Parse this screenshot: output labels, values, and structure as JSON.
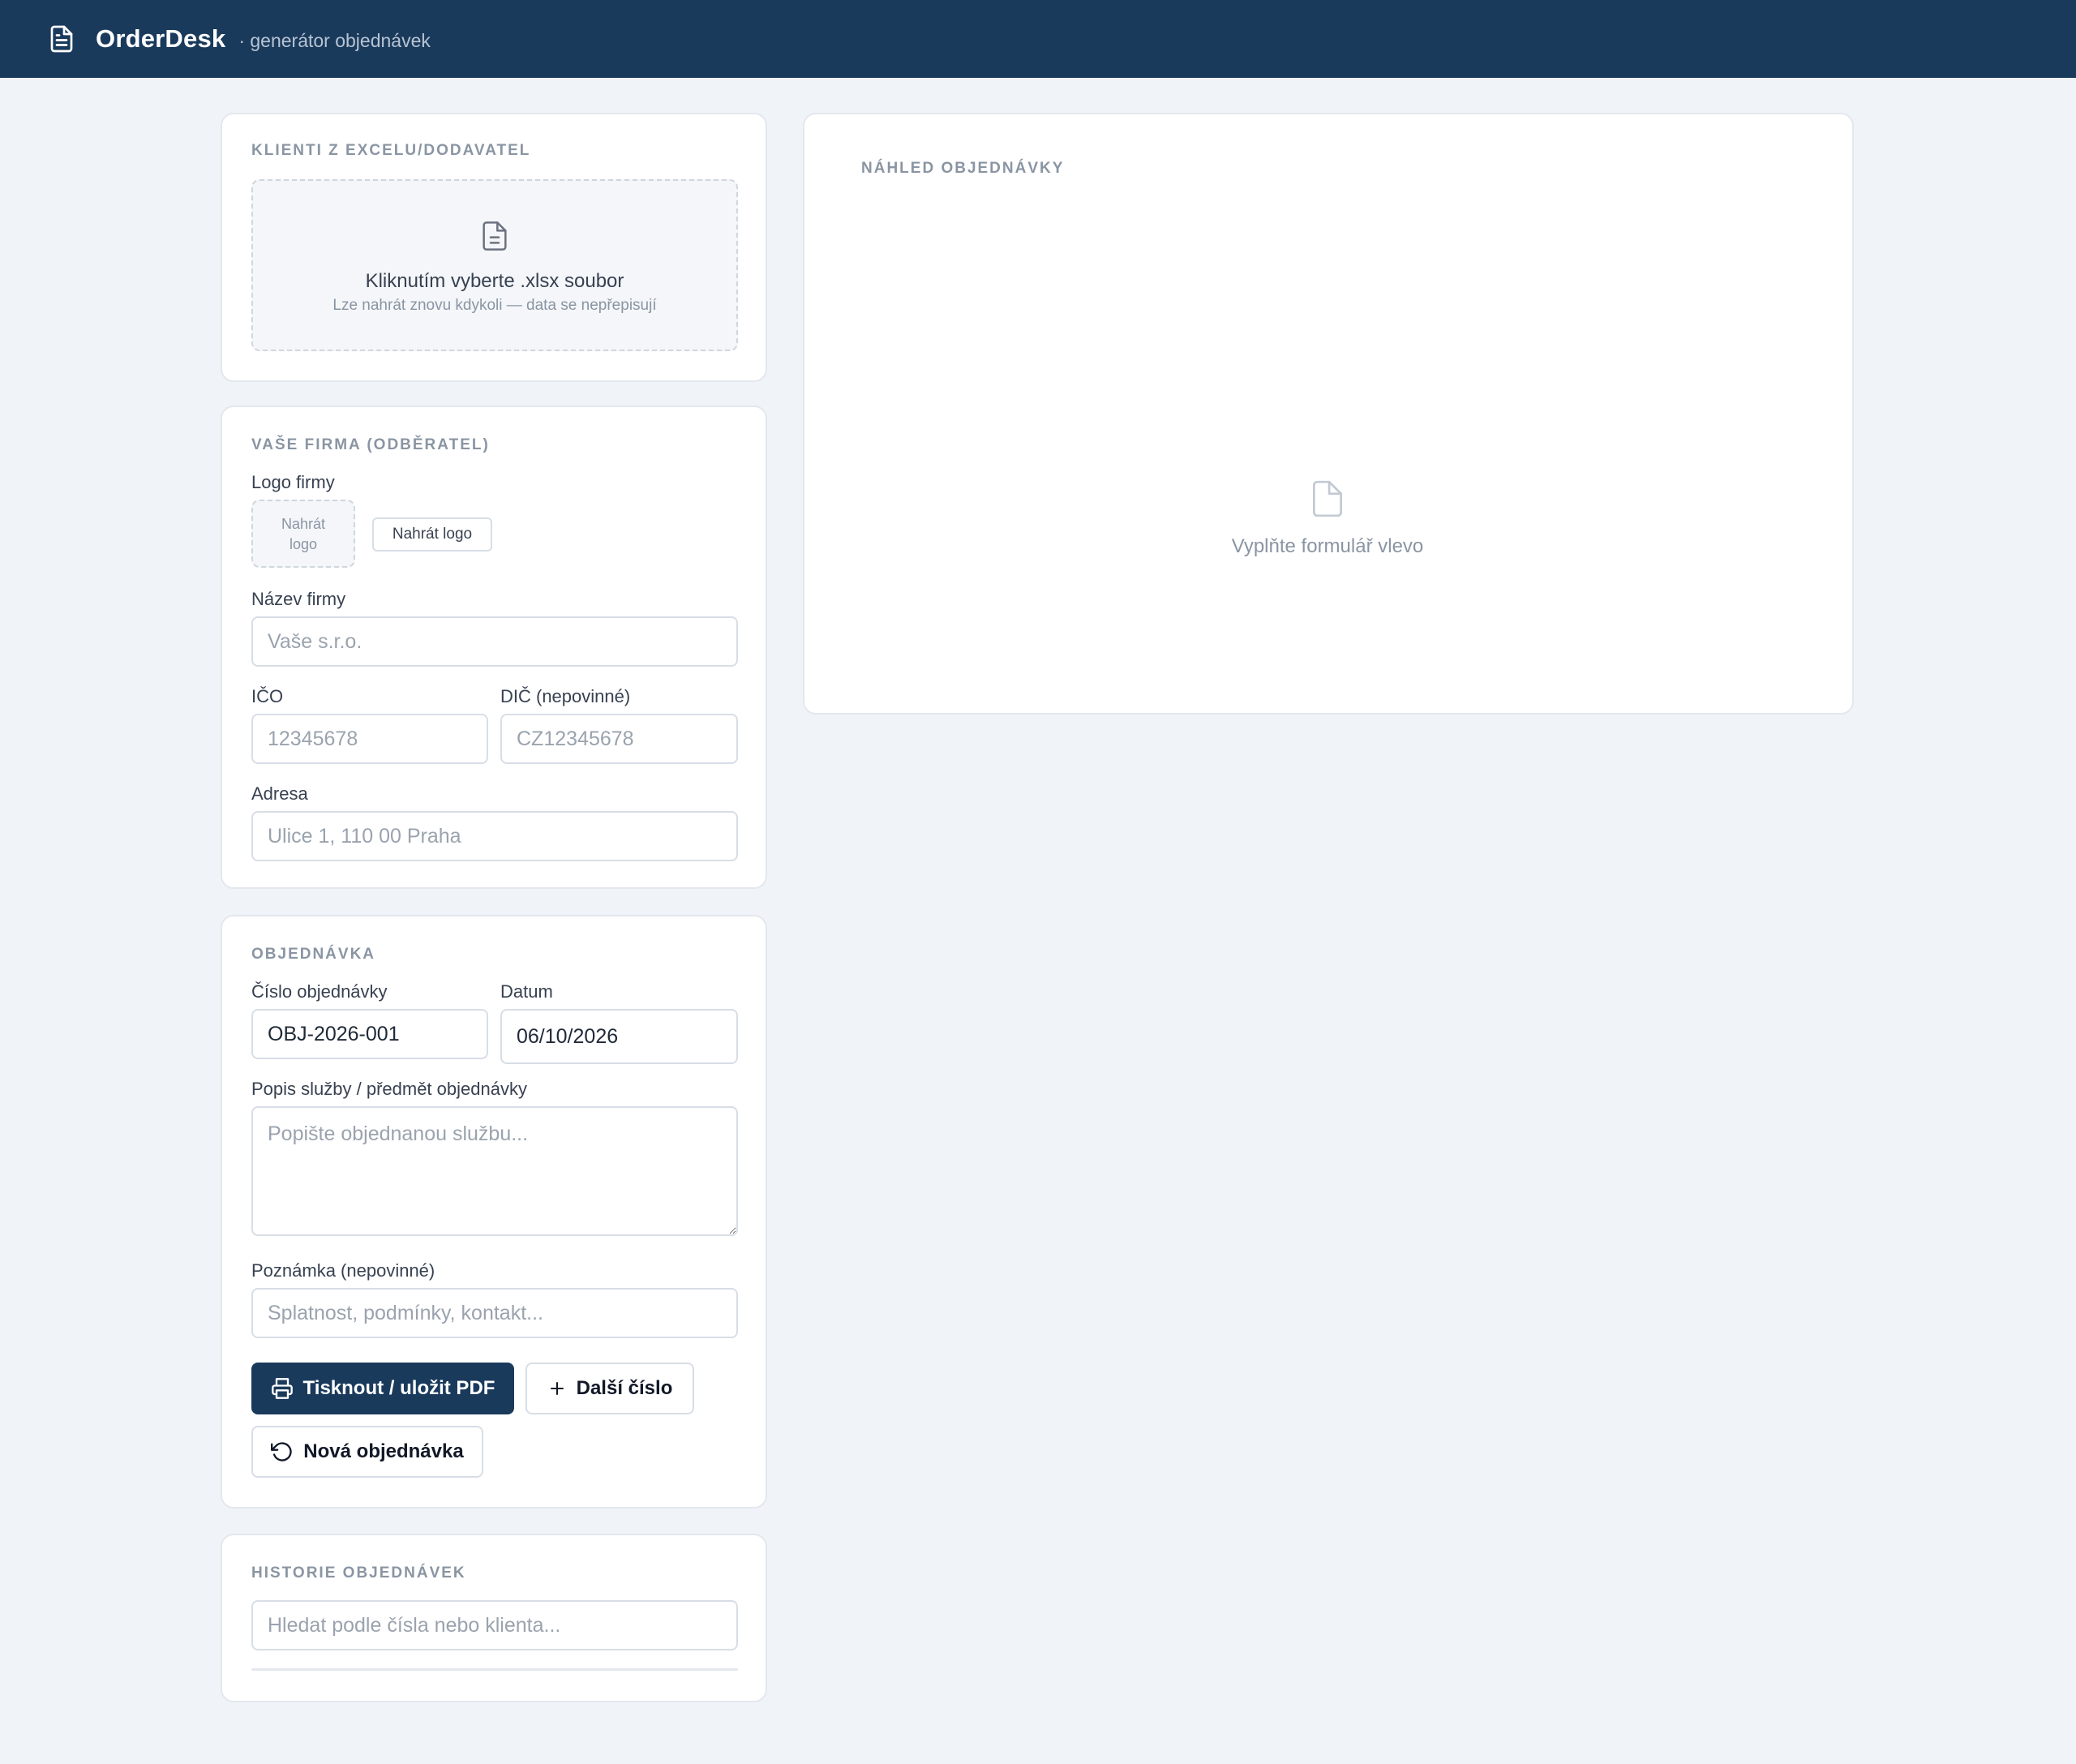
{
  "header": {
    "app_name": "OrderDesk",
    "subtitle": "· generátor objednávek"
  },
  "import_card": {
    "title": "KLIENTI Z EXCELU/DODAVATEL",
    "dropzone_main": "Kliknutím vyberte .xlsx soubor",
    "dropzone_sub": "Lze nahrát znovu kdykoli — data se nepřepisují"
  },
  "company_card": {
    "title": "VAŠE FIRMA (ODBĚRATEL)",
    "logo_label": "Logo firmy",
    "logo_placeholder_line1": "Nahrát",
    "logo_placeholder_line2": "logo",
    "logo_button": "Nahrát logo",
    "name_label": "Název firmy",
    "name_placeholder": "Vaše s.r.o.",
    "ico_label": "IČO",
    "ico_placeholder": "12345678",
    "dic_label": "DIČ (nepovinné)",
    "dic_placeholder": "CZ12345678",
    "address_label": "Adresa",
    "address_placeholder": "Ulice 1, 110 00 Praha"
  },
  "order_card": {
    "title": "OBJEDNÁVKA",
    "number_label": "Číslo objednávky",
    "number_value": "OBJ-2026-001",
    "date_label": "Datum",
    "date_value": "06/10/2026",
    "description_label": "Popis služby / předmět objednávky",
    "description_placeholder": "Popište objednanou službu...",
    "note_label": "Poznámka (nepovinné)",
    "note_placeholder": "Splatnost, podmínky, kontakt...",
    "print_button": "Tisknout / uložit PDF",
    "next_number_button": "Další číslo",
    "new_order_button": "Nová objednávka"
  },
  "history_card": {
    "title": "HISTORIE OBJEDNÁVEK",
    "search_placeholder": "Hledat podle čísla nebo klienta..."
  },
  "preview_card": {
    "title": "NÁHLED OBJEDNÁVKY",
    "empty_text": "Vyplňte formulář vlevo"
  },
  "colors": {
    "header_bg": "#1a3a5c",
    "page_bg": "#f0f4f8",
    "primary": "#1a3a5c"
  },
  "icons": {
    "app_logo": "document-icon",
    "dropzone": "file-text-icon",
    "print": "printer-icon",
    "add": "plus-icon",
    "reset": "rotate-ccw-icon",
    "preview_empty": "file-icon"
  }
}
